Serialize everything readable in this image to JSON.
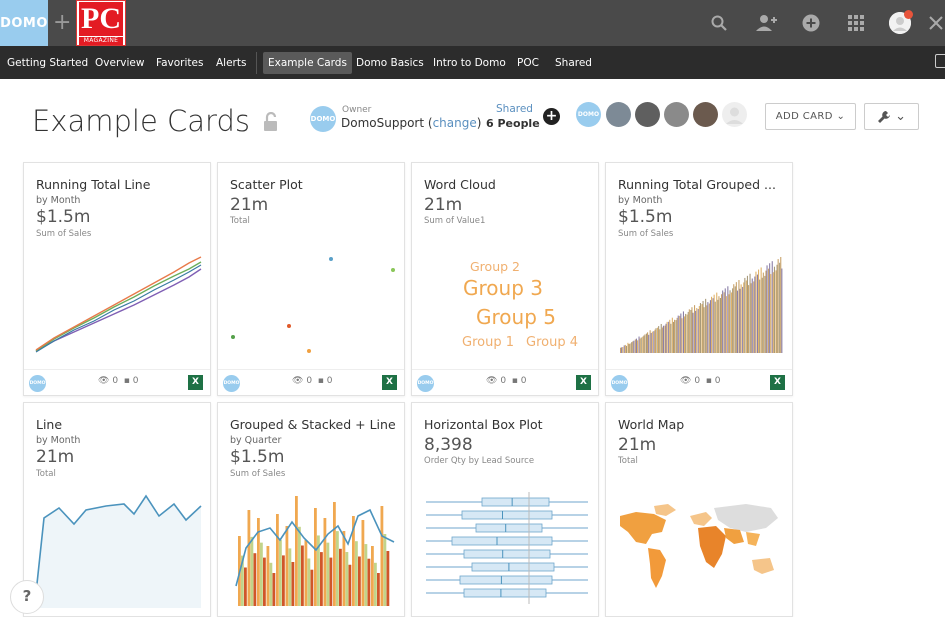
{
  "brand": {
    "domo": "DOMO",
    "plus": "+",
    "pc": "PC",
    "magazine": "MAGAZINE"
  },
  "top_icons": [
    "search-icon",
    "add-user-icon",
    "add-circle-icon",
    "app-grid-icon",
    "avatar",
    "close-icon"
  ],
  "nav": {
    "items": [
      "Getting Started",
      "Overview",
      "Favorites",
      "Alerts",
      "Example Cards",
      "Domo Basics",
      "Intro to Domo",
      "POC",
      "Shared"
    ],
    "active": "Example Cards"
  },
  "page": {
    "title": "Example Cards",
    "owner_label": "Owner",
    "owner_name": "DomoSupport",
    "owner_change": "change",
    "shared_label": "Shared",
    "shared_count": "6 People",
    "add_card": "ADD CARD"
  },
  "cards": [
    {
      "title": "Running Total Line",
      "subtitle": "by Month",
      "value": "$1.5m",
      "metric": "Sum of Sales",
      "views": "0",
      "comments": "0"
    },
    {
      "title": "Scatter Plot",
      "subtitle": "",
      "value": "21m",
      "metric": "Total",
      "views": "0",
      "comments": "0"
    },
    {
      "title": "Word Cloud",
      "subtitle": "",
      "value": "21m",
      "metric": "Sum of Value1",
      "views": "0",
      "comments": "0",
      "words": [
        "Group 2",
        "Group 3",
        "Group 5",
        "Group 1",
        "Group 4"
      ]
    },
    {
      "title": "Running Total Grouped ...",
      "subtitle": "by Month",
      "value": "$1.5m",
      "metric": "Sum of Sales",
      "views": "0",
      "comments": "0"
    },
    {
      "title": "Line",
      "subtitle": "by Month",
      "value": "21m",
      "metric": "Total"
    },
    {
      "title": "Grouped & Stacked + Line",
      "subtitle": "by Quarter",
      "value": "$1.5m",
      "metric": "Sum of Sales"
    },
    {
      "title": "Horizontal Box Plot",
      "subtitle": "",
      "value": "8,398",
      "metric": "Order Qty by Lead Source"
    },
    {
      "title": "World Map",
      "subtitle": "",
      "value": "21m",
      "metric": "Total"
    }
  ],
  "footer_avatar": "DOMO",
  "excel": "X",
  "help": "?"
}
